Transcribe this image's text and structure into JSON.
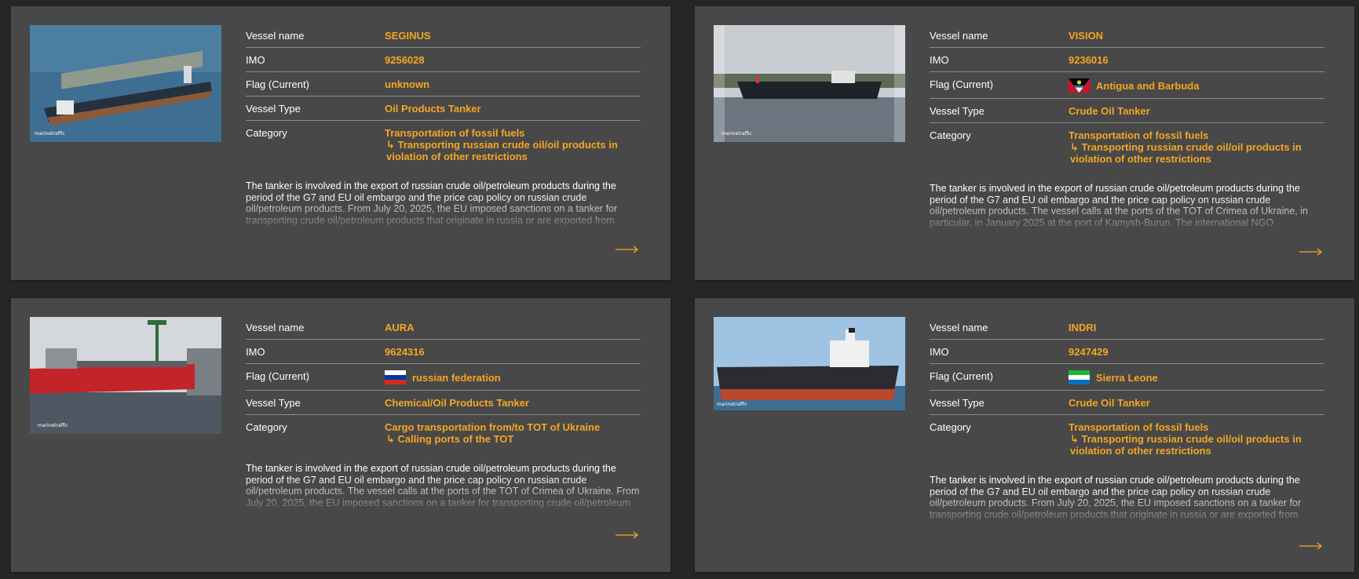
{
  "labels": {
    "vessel_name": "Vessel name",
    "imo": "IMO",
    "flag": "Flag (Current)",
    "vessel_type": "Vessel Type",
    "category": "Category"
  },
  "colors": {
    "accent": "#f5a623",
    "card": "#484848",
    "background": "#262626"
  },
  "cards": [
    {
      "vessel_name": "SEGINUS",
      "imo": "9256028",
      "flag": "unknown",
      "flag_icon": "",
      "vessel_type": "Oil Products Tanker",
      "category_main": "Transportation of fossil fuels",
      "category_sub": "↳ Transporting russian crude oil/oil products in violation of other restrictions",
      "description": "The tanker is involved in the export of russian crude oil/petroleum products during the period of the G7 and EU oil embargo and the price cap policy on russian crude oil/petroleum products. From July 20, 2025, the EU imposed sanctions on a tanker for transporting crude oil/petroleum products that originate in russia or are exported from russia using irregular and high-risk shipping practices as set out in the",
      "photo_credit": "marinetraffic"
    },
    {
      "vessel_name": "VISION",
      "imo": "9236016",
      "flag": "Antigua and Barbuda",
      "flag_icon": "antigua-flag-icon",
      "vessel_type": "Crude Oil Tanker",
      "category_main": "Transportation of fossil fuels",
      "category_sub": "↳ Transporting russian crude oil/oil products in violation of other restrictions",
      "description": "The tanker is involved in the export of russian crude oil/petroleum products during the period of the G7 and EU oil embargo and the price cap policy on russian crude oil/petroleum products. The vessel calls at the ports of the TOT of Crimea of Ukraine, in particular, in January 2025 at the port of Kamysh-Burun. The international NGO Greenpeace refers to the tanker as part of a shadow fleet of tankers that transport",
      "photo_credit": "marinetraffic"
    },
    {
      "vessel_name": "AURA",
      "imo": "9624316",
      "flag": "russian federation",
      "flag_icon": "russia-flag-icon",
      "vessel_type": "Chemical/Oil Products Tanker",
      "category_main": "Cargo transportation from/to TOT of Ukraine",
      "category_sub": "↳ Calling ports of the TOT",
      "description": "The tanker is involved in the export of russian crude oil/petroleum products during the period of the G7 and EU oil embargo and the price cap policy on russian crude oil/petroleum products. The vessel calls at the ports of the TOT of Crimea of Ukraine. From July 20, 2025, the EU imposed sanctions on a tanker for transporting crude oil/petroleum products that originate in russia or are exported from russia using",
      "photo_credit": "marinetraffic"
    },
    {
      "vessel_name": "INDRI",
      "imo": "9247429",
      "flag": "Sierra Leone",
      "flag_icon": "sierra-leone-flag-icon",
      "vessel_type": "Crude Oil Tanker",
      "category_main": "Transportation of fossil fuels",
      "category_sub": "↳ Transporting russian crude oil/oil products in violation of other restrictions",
      "description": "The tanker is involved in the export of russian crude oil/petroleum products during the period of the G7 and EU oil embargo and the price cap policy on russian crude oil/petroleum products. From July 20, 2025, the EU imposed sanctions on a tanker for transporting crude oil/petroleum products that originate in russia or are exported from russia using irregular and high-risk shipping practices as set out in the",
      "photo_credit": "marinetraffic"
    }
  ]
}
